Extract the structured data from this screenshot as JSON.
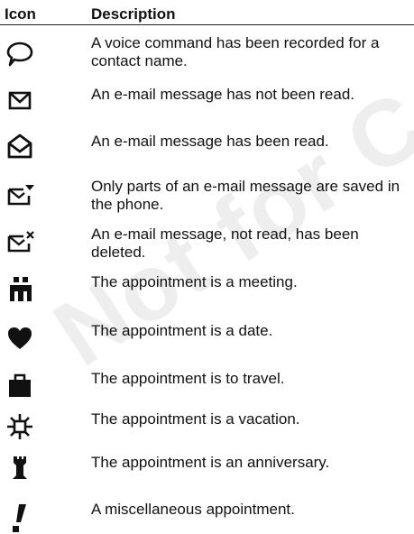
{
  "table": {
    "header": {
      "icon": "Icon",
      "description": "Description"
    },
    "rows": [
      {
        "icon": "speech-bubble-icon",
        "description": "A voice command has been recorded for a contact name."
      },
      {
        "icon": "envelope-closed-icon",
        "description": "An e-mail message has not been read."
      },
      {
        "icon": "envelope-open-icon",
        "description": "An e-mail message has been read."
      },
      {
        "icon": "envelope-partial-icon",
        "description": "Only parts of an e-mail message are saved in the phone."
      },
      {
        "icon": "envelope-deleted-icon",
        "description": "An e-mail message, not read, has been deleted."
      },
      {
        "icon": "meeting-people-icon",
        "description": "The appointment is a meeting."
      },
      {
        "icon": "heart-icon",
        "description": "The appointment is a date."
      },
      {
        "icon": "briefcase-icon",
        "description": "The appointment is to travel."
      },
      {
        "icon": "sun-icon",
        "description": "The appointment is a vacation."
      },
      {
        "icon": "tower-icon",
        "description": "The appointment is an anniversary."
      },
      {
        "icon": "exclamation-icon",
        "description": "A miscellaneous appointment."
      }
    ]
  },
  "watermark": "Not for Com"
}
